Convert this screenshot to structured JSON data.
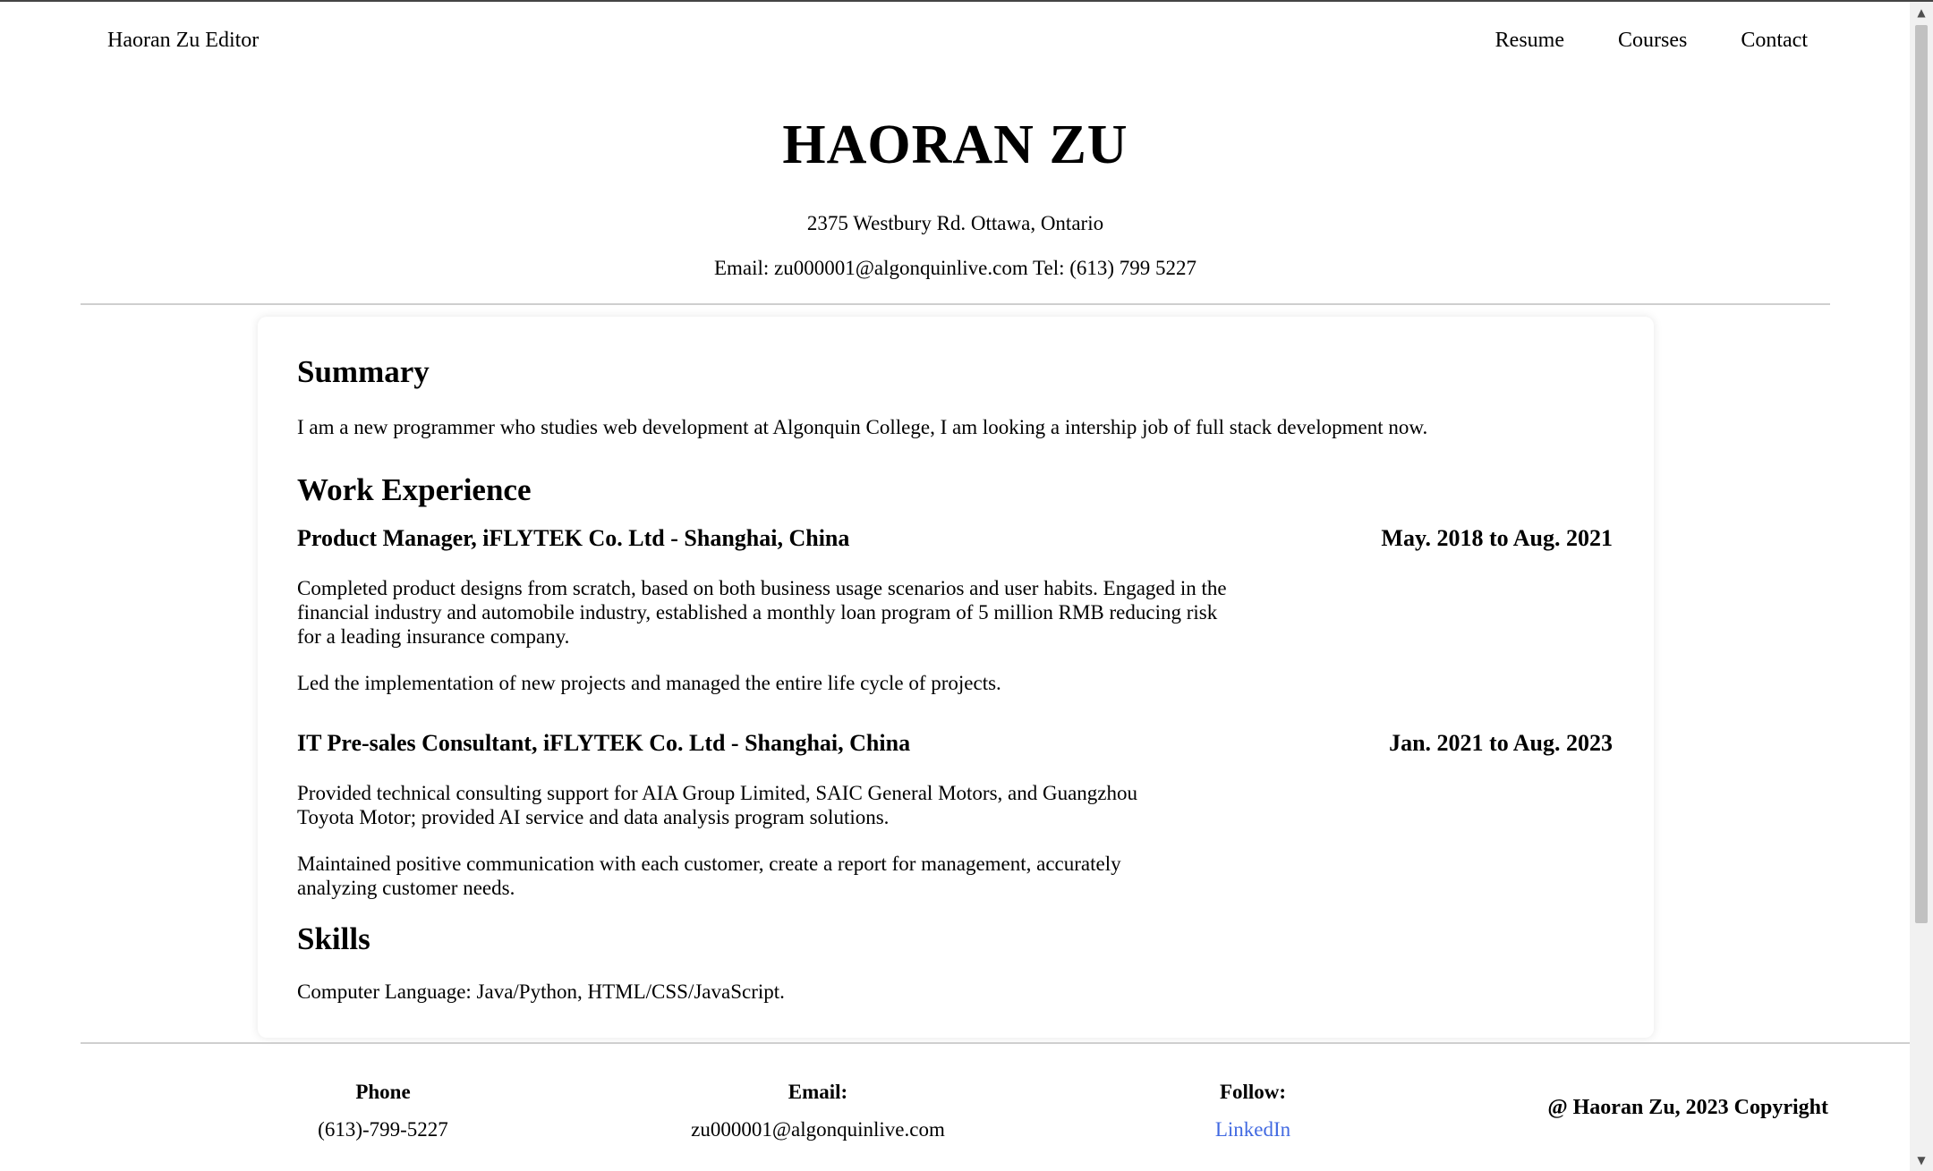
{
  "nav": {
    "brand": "Haoran Zu Editor",
    "links": [
      "Resume",
      "Courses",
      "Contact"
    ]
  },
  "header": {
    "name": "HAORAN ZU",
    "address": "2375 Westbury Rd. Ottawa, Ontario",
    "contact": "Email: zu000001@algonquinlive.com Tel: (613) 799 5227"
  },
  "summary": {
    "heading": "Summary",
    "text": "I am a new programmer who studies web development at Algonquin College, I am looking a intership job of full stack development now."
  },
  "work": {
    "heading": "Work Experience",
    "jobs": [
      {
        "title": "Product Manager, iFLYTEK Co. Ltd - Shanghai, China",
        "date": "May. 2018 to Aug. 2021",
        "paragraphs": [
          "Completed product designs from scratch, based on both business usage scenarios and user habits. Engaged in the financial industry and automobile industry, established a monthly loan program of 5 million RMB reducing risk for a leading insurance company.",
          "Led the implementation of new projects and managed the entire life cycle of projects."
        ]
      },
      {
        "title": "IT Pre-sales Consultant, iFLYTEK Co. Ltd - Shanghai, China",
        "date": "Jan. 2021 to Aug. 2023",
        "paragraphs": [
          "Provided technical consulting support for AIA Group Limited, SAIC General Motors, and Guangzhou Toyota Motor; provided AI service and data analysis program solutions.",
          "Maintained positive communication with each customer, create a report for management, accurately analyzing customer needs."
        ]
      }
    ]
  },
  "skills": {
    "heading": "Skills",
    "items": [
      "Computer Language: Java/Python, HTML/CSS/JavaScript."
    ]
  },
  "footer": {
    "phone_label": "Phone",
    "phone_value": "(613)-799-5227",
    "email_label": "Email:",
    "email_value": "zu000001@algonquinlive.com",
    "follow_label": "Follow:",
    "follow_link": "LinkedIn",
    "copyright": "@ Haoran Zu, 2023 Copyright"
  },
  "colors": {
    "link": "#4169e1",
    "rule": "#cfcfcf",
    "scroll_thumb": "#c1c1c1"
  }
}
